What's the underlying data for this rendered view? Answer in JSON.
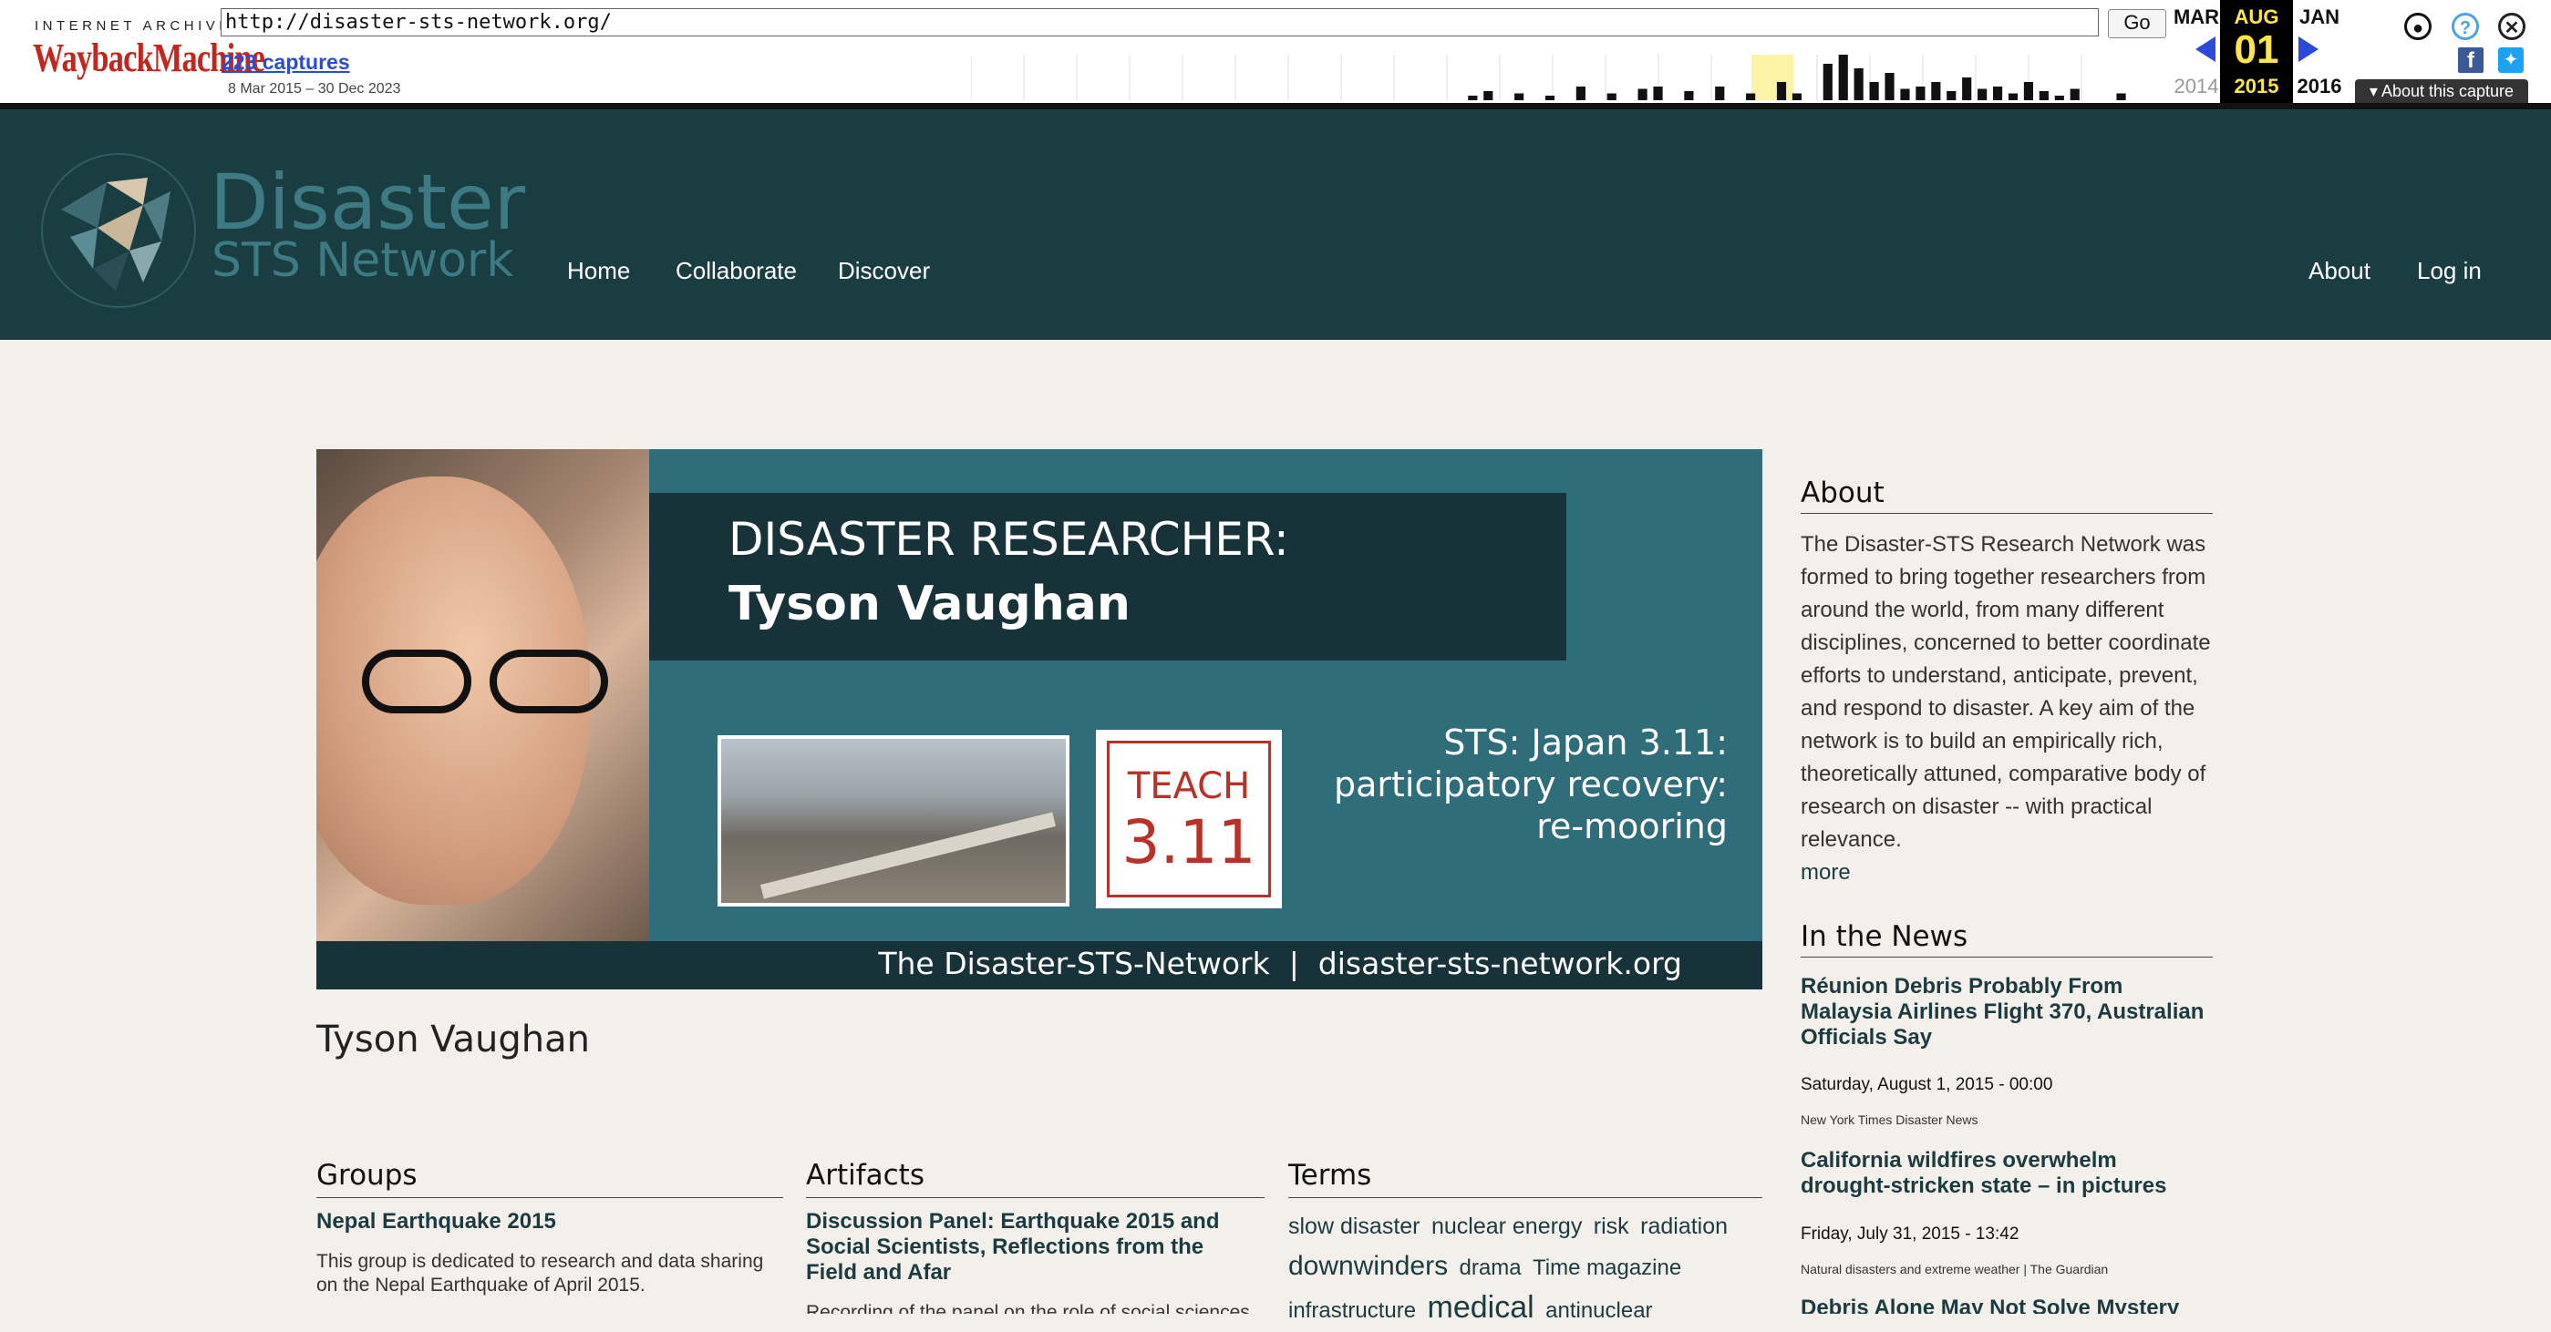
{
  "wayback": {
    "ia_label": "INTERNET ARCHIVE",
    "logo_text": "WaybackMachine",
    "url": "http://disaster-sts-network.org/",
    "go_label": "Go",
    "captures_label": "223 captures",
    "date_range": "8 Mar 2015 – 30 Dec 2023",
    "prev_month": "MAR",
    "cur_month": "AUG",
    "next_month": "JAN",
    "cur_day": "01",
    "prev_year": "2014",
    "cur_year": "2015",
    "next_year": "2016",
    "about_capture": "About this capture",
    "sparkline": [
      0,
      0,
      0,
      0,
      0,
      0,
      0,
      0,
      0,
      0,
      0,
      0,
      0,
      0,
      0,
      0,
      0,
      0,
      0,
      0,
      0,
      0,
      0,
      0,
      0,
      0,
      0,
      0,
      0,
      0,
      0,
      0,
      2,
      4,
      0,
      3,
      0,
      2,
      0,
      6,
      0,
      3,
      0,
      5,
      6,
      0,
      4,
      0,
      6,
      0,
      3,
      0,
      8,
      3,
      0,
      16,
      20,
      14,
      8,
      12,
      5,
      6,
      8,
      4,
      10,
      5,
      6,
      3,
      8,
      4,
      2,
      5,
      0,
      0,
      3
    ]
  },
  "site": {
    "name": "Disaster",
    "subname": "STS Network",
    "nav_left": [
      "Home",
      "Collaborate",
      "Discover"
    ],
    "nav_right": [
      "About",
      "Log in"
    ],
    "colors": {
      "header_bg": "#1a3d42",
      "page_bg": "#f3f0eb",
      "link": "#1c3b40"
    }
  },
  "banner": {
    "line1": "DISASTER RESEARCHER:",
    "line2": "Tyson Vaughan",
    "teach_word": "TEACH",
    "teach_num": "3.11",
    "sts_lines": [
      "STS: Japan 3.11:",
      "participatory recovery:",
      "re-mooring"
    ],
    "footer": "The Disaster-STS-Network  |  disaster-sts-network.org"
  },
  "page_title": "Tyson Vaughan",
  "groups": {
    "heading": "Groups",
    "item_title": "Nepal Earthquake 2015",
    "item_desc": "This group is dedicated to research and data sharing on the Nepal Earthquake of April 2015."
  },
  "artifacts": {
    "heading": "Artifacts",
    "item_title": "Discussion Panel: Earthquake 2015 and Social Scientists, Reflections from the Field and Afar",
    "item_desc": "Recording of the panel on the role of social sciences"
  },
  "terms": {
    "heading": "Terms",
    "items": [
      {
        "text": "slow disaster",
        "size": 25
      },
      {
        "text": "nuclear energy",
        "size": 25
      },
      {
        "text": "risk",
        "size": 25
      },
      {
        "text": "radiation",
        "size": 25
      },
      {
        "text": "downwinders",
        "size": 30
      },
      {
        "text": "drama",
        "size": 24
      },
      {
        "text": "Time magazine",
        "size": 24
      },
      {
        "text": "infrastructure",
        "size": 24
      },
      {
        "text": "medical",
        "size": 34
      },
      {
        "text": "antinuclear",
        "size": 24
      }
    ]
  },
  "sidebar": {
    "about_heading": "About",
    "about_text": "The Disaster-STS Research Network  was formed to bring together researchers from around the world, from many different disciplines, concerned to better coordinate efforts to understand, anticipate, prevent, and respond to disaster.  A key aim of the network is to build an empirically rich, theoretically attuned, comparative body of research on disaster -- with practical relevance.",
    "more_label": "more",
    "news_heading": "In the News",
    "news": [
      {
        "title": "Réunion Debris Probably From Malaysia Airlines Flight 370, Australian Officials Say",
        "date": "Saturday, August 1, 2015 - 00:00",
        "source": "New York Times Disaster News"
      },
      {
        "title": "California wildfires overwhelm drought-stricken state – in pictures",
        "date": "Friday, July 31, 2015 - 13:42",
        "source": "Natural disasters and extreme weather | The Guardian"
      },
      {
        "title": "Debris Alone May Not Solve Mystery",
        "date": "",
        "source": ""
      }
    ]
  }
}
